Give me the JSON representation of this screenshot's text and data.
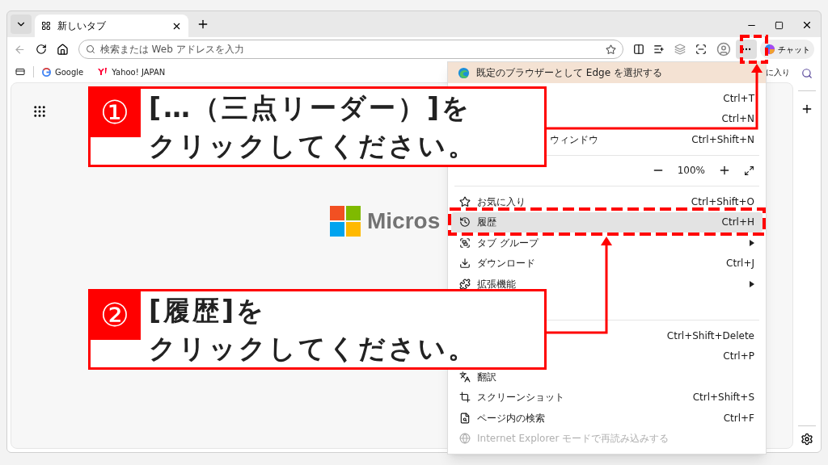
{
  "tabs": [
    {
      "label": "新しいタブ",
      "selected": true
    }
  ],
  "address_bar": {
    "placeholder": "検索または Web アドレスを入力"
  },
  "chat_button": {
    "label": "チャット"
  },
  "bookmarks": [
    {
      "label": "Google",
      "kind": "google"
    },
    {
      "label": "Yahoo! JAPAN",
      "kind": "yahoo"
    }
  ],
  "bookmarks_overflow": "に入り",
  "page": {
    "logo_text": "Micros"
  },
  "menu": {
    "banner": "既定のブラウザーとして Edge を選択する",
    "groups": [
      [
        {
          "kind": "item",
          "shortcut": "Ctrl+T",
          "submenu": false,
          "disabled": false,
          "selected": false
        },
        {
          "kind": "item",
          "shortcut": "Ctrl+N",
          "submenu": false,
          "disabled": false,
          "selected": false
        },
        {
          "kind": "item",
          "covered": true,
          "label": "ウィンドウ",
          "shortcut": "Ctrl+Shift+N",
          "submenu": false,
          "disabled": false,
          "selected": false
        }
      ],
      [
        {
          "kind": "zoom",
          "value": "100%"
        }
      ],
      [
        {
          "kind": "item",
          "covered": false,
          "label": "お気に入り",
          "shortcut": "Ctrl+Shift+O",
          "submenu": false,
          "disabled": false,
          "selected": false
        },
        {
          "kind": "item",
          "covered": false,
          "label": "履歴",
          "shortcut": "Ctrl+H",
          "submenu": false,
          "disabled": false,
          "selected": true
        },
        {
          "kind": "item",
          "covered": false,
          "label": "タブ グループ",
          "submenu": true,
          "disabled": false,
          "selected": false
        },
        {
          "kind": "item",
          "covered": false,
          "label": "ダウンロード",
          "shortcut": "Ctrl+J",
          "submenu": false,
          "disabled": false,
          "selected": false
        },
        {
          "kind": "item",
          "covered": false,
          "label": "拡張機能",
          "submenu": true,
          "disabled": false,
          "selected": false
        },
        {
          "kind": "item",
          "submenu": false,
          "selected": false
        }
      ],
      [
        {
          "kind": "item",
          "shortcut": "Ctrl+Shift+Delete",
          "submenu": false,
          "disabled": false,
          "selected": false
        },
        {
          "kind": "item",
          "shortcut": "Ctrl+P",
          "submenu": false,
          "disabled": false,
          "selected": false
        },
        {
          "kind": "item",
          "covered": false,
          "label": "翻訳",
          "submenu": false,
          "disabled": false,
          "selected": false
        },
        {
          "kind": "item",
          "covered": false,
          "label": "スクリーンショット",
          "shortcut": "Ctrl+Shift+S",
          "submenu": false,
          "disabled": false,
          "selected": false
        },
        {
          "kind": "item",
          "covered": false,
          "label": "ページ内の検索",
          "shortcut": "Ctrl+F",
          "submenu": false,
          "disabled": false,
          "selected": false
        },
        {
          "kind": "item",
          "covered": false,
          "label": "Internet Explorer モードで再読み込みする",
          "submenu": false,
          "disabled": true,
          "selected": false
        }
      ]
    ]
  },
  "callouts": [
    {
      "number": "①",
      "lines": [
        "[…（三点リーダー）]を",
        "クリックしてください。"
      ]
    },
    {
      "number": "②",
      "lines": [
        "[履歴]を",
        "クリックしてください。"
      ]
    }
  ]
}
